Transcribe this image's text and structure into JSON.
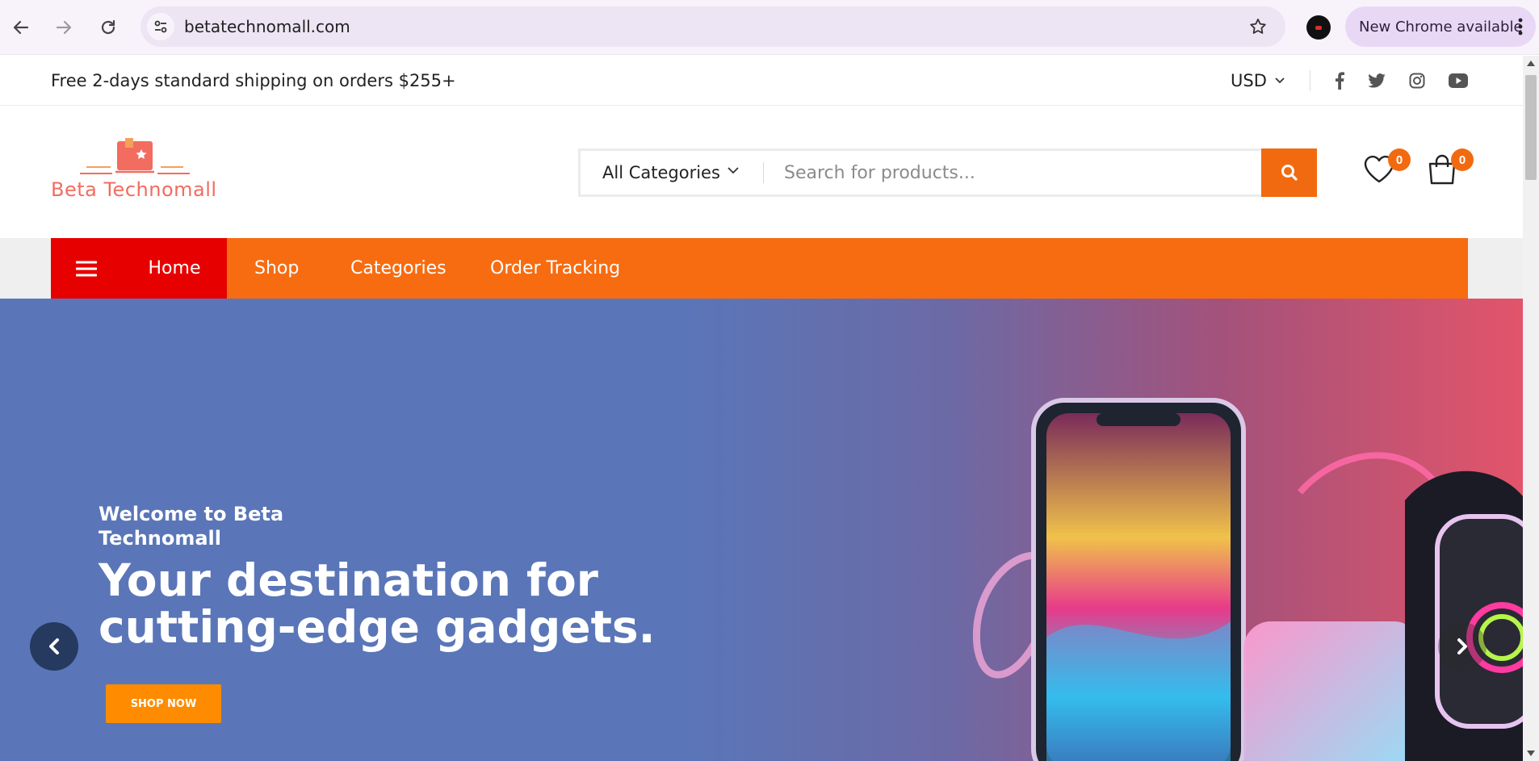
{
  "browser": {
    "url": "betatechnomall.com",
    "update_label": "New Chrome available"
  },
  "topbar": {
    "shipping_text": "Free 2-days standard shipping on orders $255+",
    "currency": "USD"
  },
  "header": {
    "logo_text": "Beta Technomall",
    "category_select": "All Categories",
    "search_placeholder": "Search for products...",
    "wishlist_count": "0",
    "cart_count": "0"
  },
  "nav": {
    "items": [
      "Home",
      "Shop",
      "Categories",
      "Order Tracking"
    ]
  },
  "hero": {
    "welcome": "Welcome to Beta Technomall",
    "headline": "Your destination for cutting-edge gadgets.",
    "cta": "SHOP NOW"
  },
  "colors": {
    "accent": "#f76c11",
    "nav_active": "#e70000",
    "hero_bg": "#5a76b8",
    "cta": "#ff8c00"
  }
}
